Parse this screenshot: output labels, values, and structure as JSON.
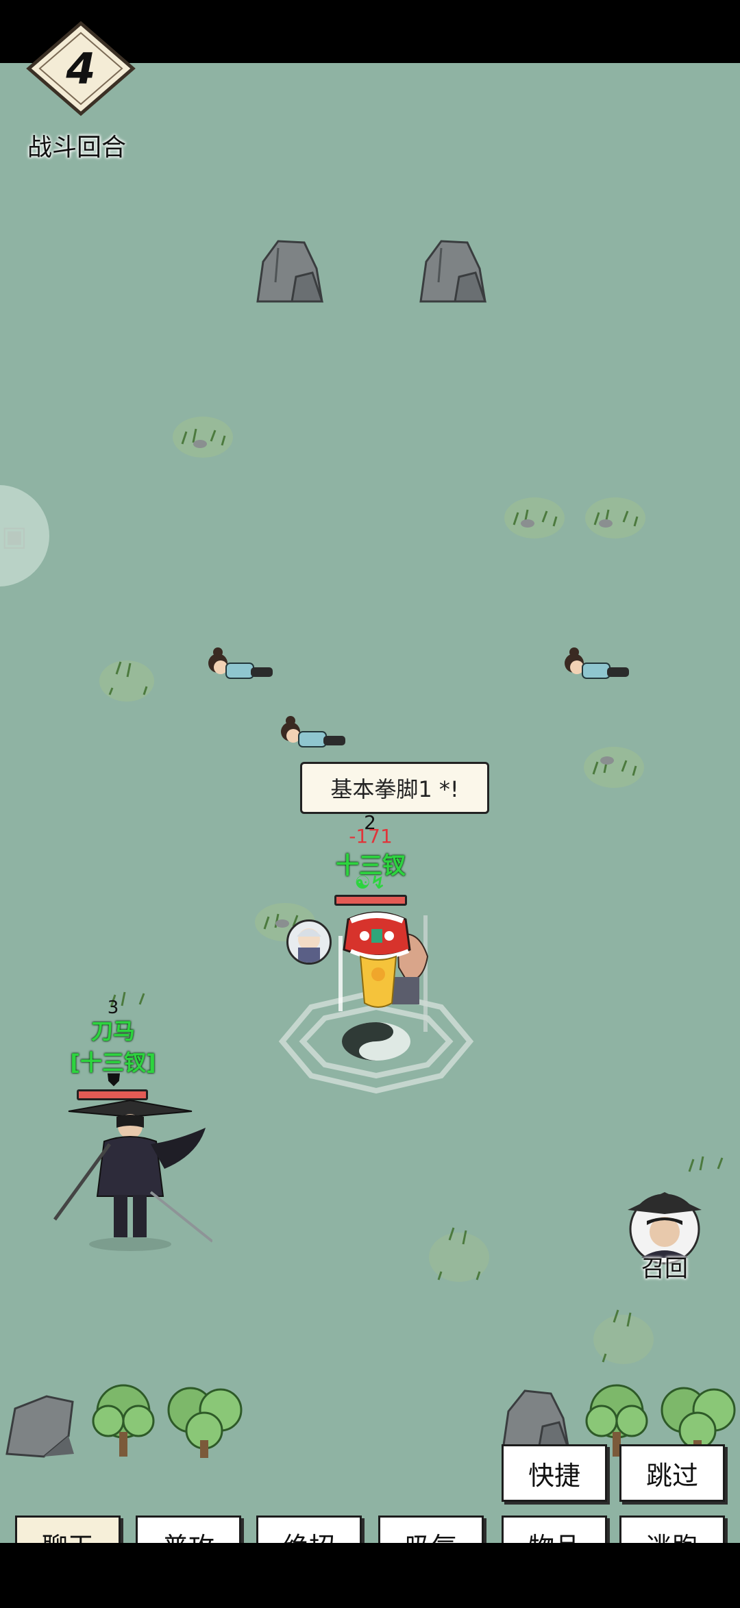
{
  "round": {
    "number": "4",
    "label": "战斗回合"
  },
  "side_tab_icon": "gift-icon",
  "battle": {
    "skill_callout": "基本拳脚1 *!",
    "target": {
      "count": "2",
      "damage": "-171",
      "name": "十三钗",
      "status_icons": "☯↯"
    },
    "ally": {
      "count": "3",
      "name": "刀马",
      "faction": "[十三钗]",
      "status_icon": "⛊"
    },
    "recall_label": "召回"
  },
  "actions": {
    "quick": "快捷",
    "skip": "跳过",
    "chat": "聊天",
    "normal_attack": "普攻",
    "ultimate": "绝招",
    "absorb_qi": "吸气",
    "items": "物品",
    "flee": "逃跑"
  },
  "colors": {
    "field": "#8fb3a3",
    "name_green": "#2dd43f",
    "damage_red": "#e0353a",
    "hp_red": "#e35b55"
  }
}
